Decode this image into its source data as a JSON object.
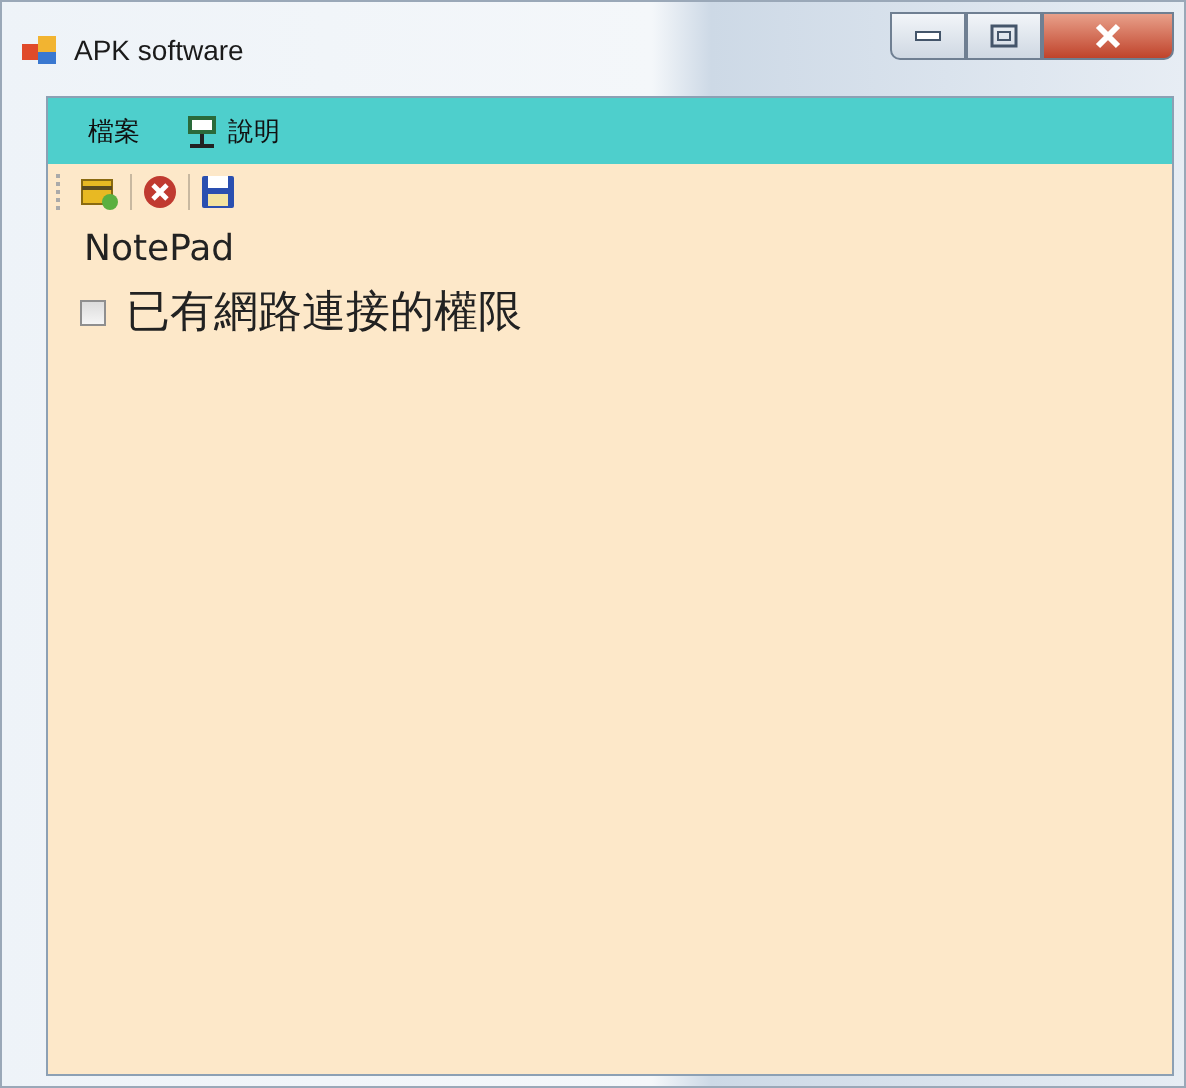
{
  "window": {
    "title": "APK software"
  },
  "menu": [
    {
      "label": "檔案",
      "kind": "plain"
    },
    {
      "label": "說明",
      "kind": "icon"
    }
  ],
  "app_name": "NotePad",
  "permission": {
    "label": "已有網路連接的權限",
    "checked": false
  }
}
